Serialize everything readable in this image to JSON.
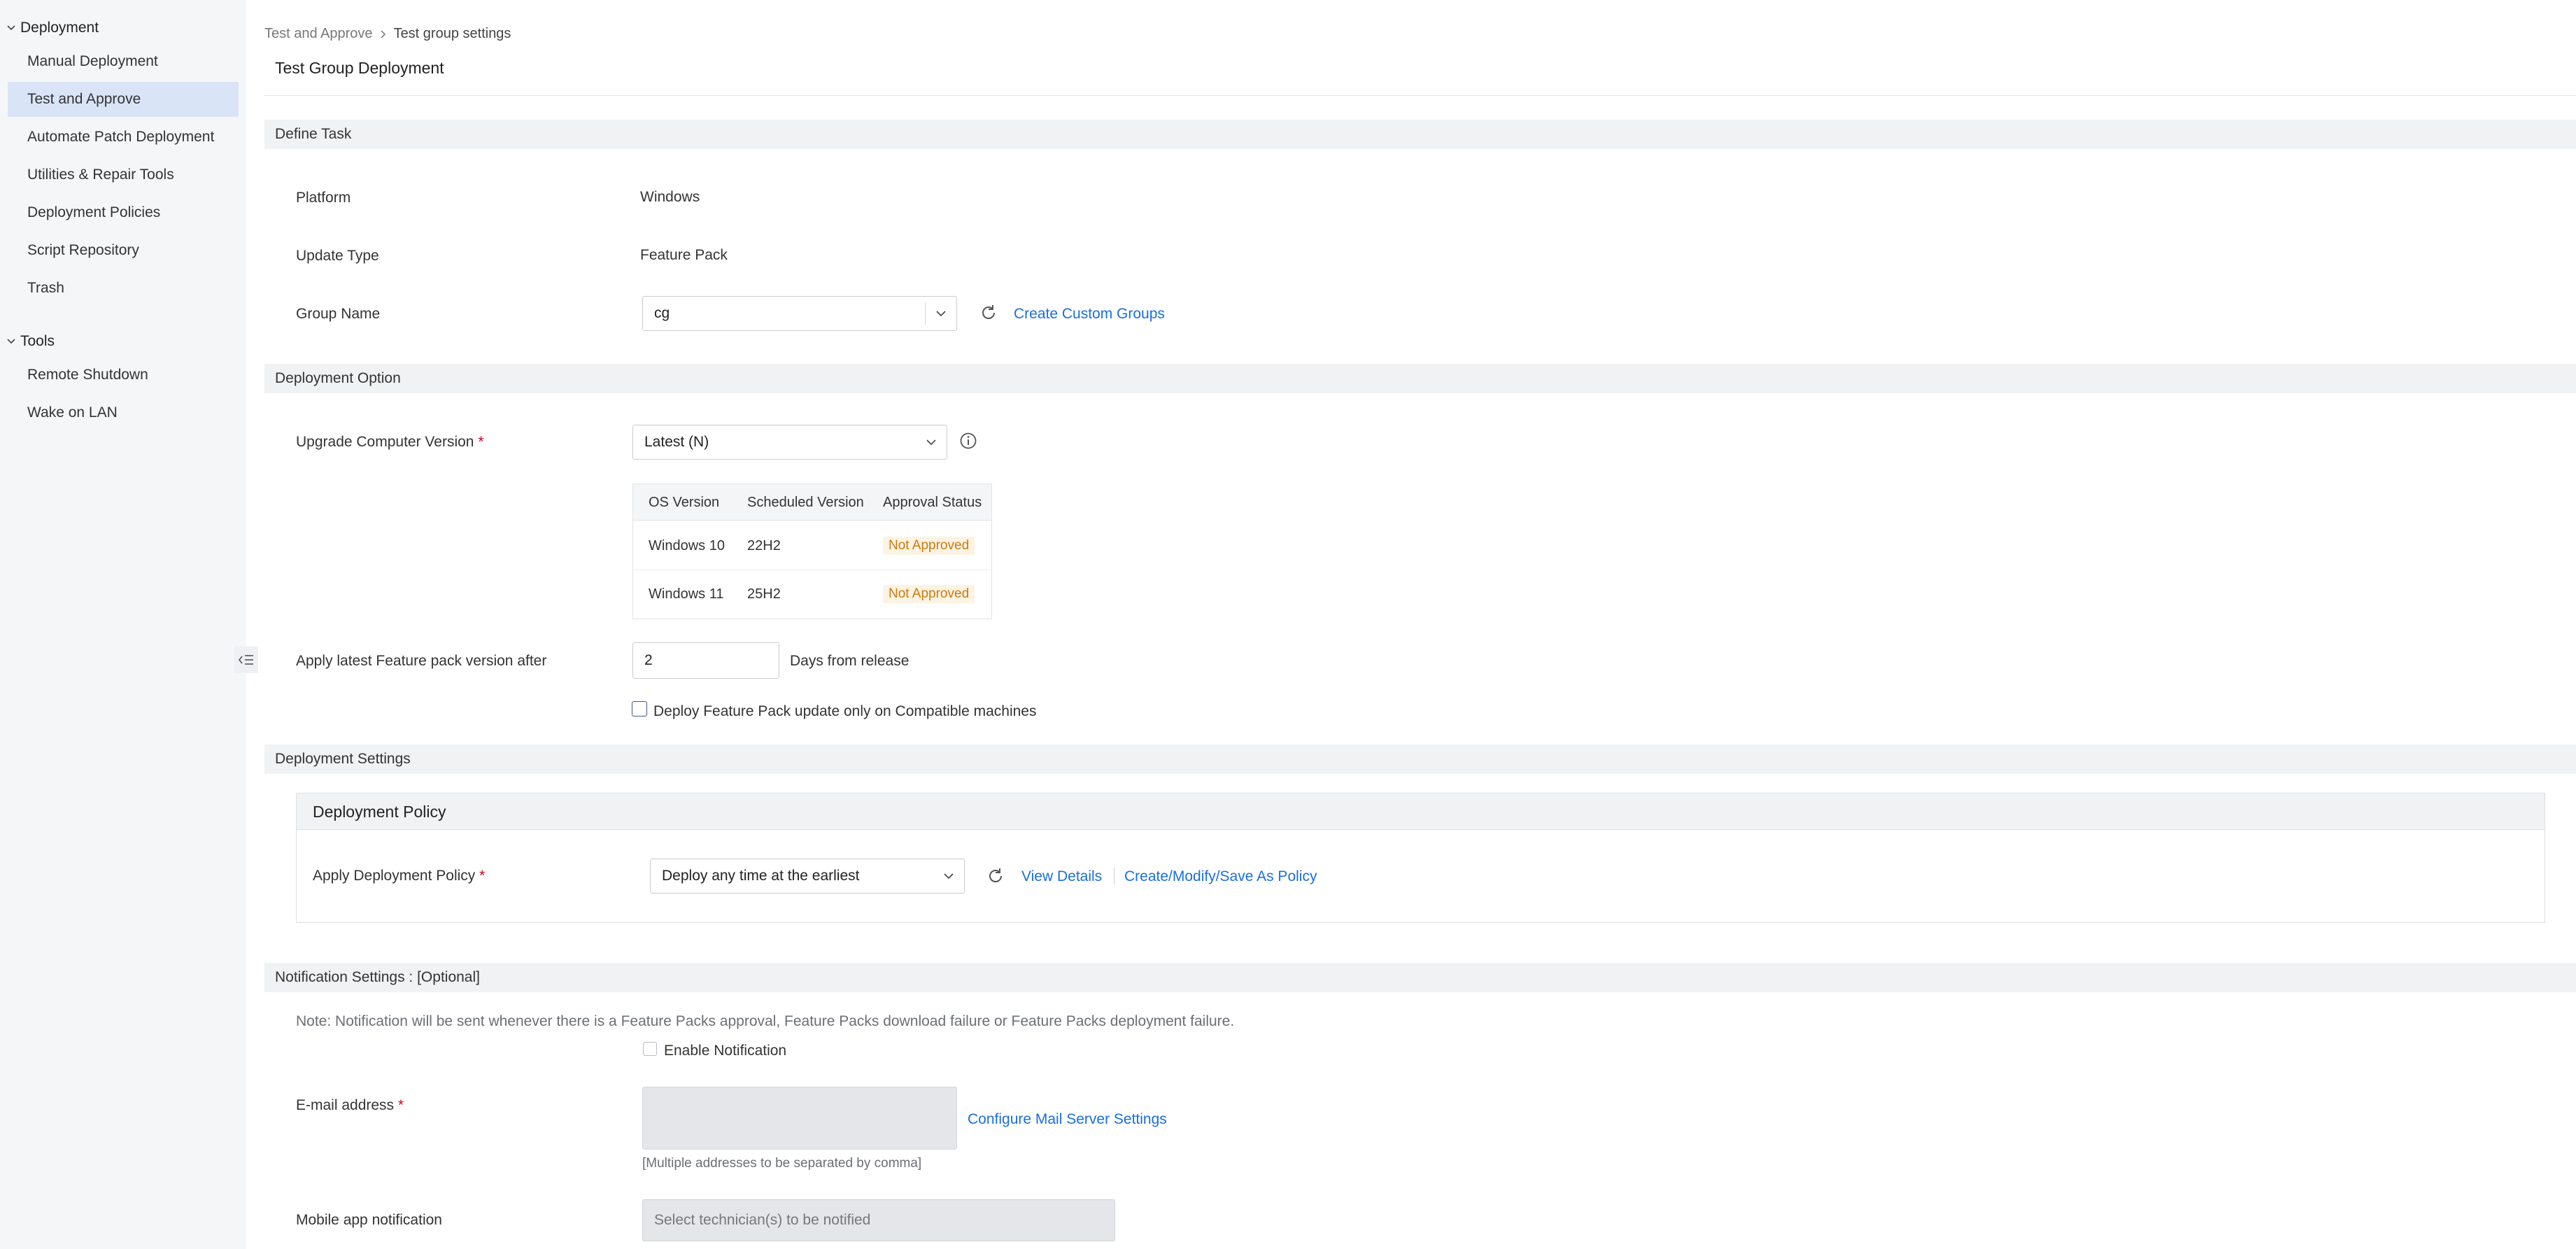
{
  "sidebar": {
    "groups": [
      {
        "label": "Deployment",
        "items": [
          {
            "label": "Manual Deployment"
          },
          {
            "label": "Test and Approve"
          },
          {
            "label": "Automate Patch Deployment"
          },
          {
            "label": "Utilities & Repair Tools"
          },
          {
            "label": "Deployment Policies"
          },
          {
            "label": "Script Repository"
          },
          {
            "label": "Trash"
          }
        ]
      },
      {
        "label": "Tools",
        "items": [
          {
            "label": "Remote Shutdown"
          },
          {
            "label": "Wake on LAN"
          }
        ]
      }
    ],
    "active_item": "Test and Approve"
  },
  "breadcrumb": {
    "parent": "Test and Approve",
    "current": "Test group settings"
  },
  "page_title": "Test Group Deployment",
  "define_task": {
    "section_title": "Define Task",
    "platform_label": "Platform",
    "platform_value": "Windows",
    "update_type_label": "Update Type",
    "update_type_value": "Feature Pack",
    "group_name_label": "Group Name",
    "group_name_value": "cg",
    "create_groups_link": "Create Custom Groups"
  },
  "deployment_option": {
    "section_title": "Deployment Option",
    "upgrade_label": "Upgrade Computer Version",
    "upgrade_required": "*",
    "upgrade_value": "Latest (N)",
    "table": {
      "headers": [
        "OS Version",
        "Scheduled Version",
        "Approval Status"
      ],
      "rows": [
        {
          "os": "Windows 10",
          "version": "22H2",
          "status": "Not Approved"
        },
        {
          "os": "Windows 11",
          "version": "25H2",
          "status": "Not Approved"
        }
      ]
    },
    "apply_after_label": "Apply latest Feature pack version after",
    "apply_after_value": "2",
    "days_suffix": "Days from release",
    "compatible_only_label": "Deploy Feature Pack update only on Compatible machines",
    "compatible_only_checked": false
  },
  "deployment_settings": {
    "section_title": "Deployment Settings",
    "policy_box_title": "Deployment Policy",
    "apply_policy_label": "Apply Deployment Policy",
    "apply_policy_required": "*",
    "apply_policy_value": "Deploy any time at the earliest",
    "view_details_link": "View Details",
    "create_policy_link": "Create/Modify/Save As Policy"
  },
  "notification": {
    "section_title": "Notification Settings : [Optional]",
    "note": "Note: Notification will be sent whenever there is a Feature Packs approval, Feature Packs download failure or Feature Packs deployment failure.",
    "enable_label": "Enable Notification",
    "enable_checked": false,
    "email_label": "E-mail address",
    "email_required": "*",
    "email_value": "",
    "configure_mail_link": "Configure Mail Server Settings",
    "email_hint": "[Multiple addresses to be separated by comma]",
    "mobile_label": "Mobile app notification",
    "mobile_placeholder": "Select technician(s) to be notified"
  },
  "colors": {
    "accent_link": "#1a6ee0",
    "active_nav_bg": "#d9e4f7",
    "badge_bg": "#fdf3e3",
    "badge_text": "#c97a0f",
    "required": "#d0021b"
  }
}
